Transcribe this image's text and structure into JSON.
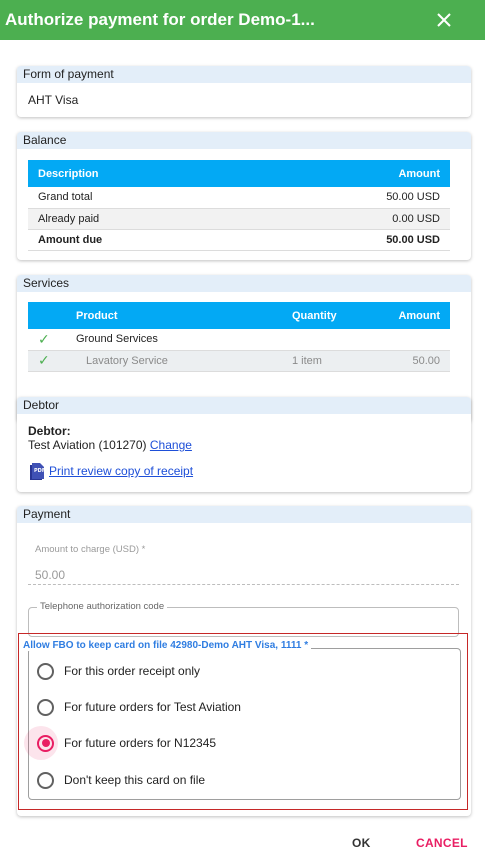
{
  "dialog": {
    "title": "Authorize payment for order Demo-1..."
  },
  "form_of_payment": {
    "heading": "Form of payment",
    "value": "AHT Visa"
  },
  "balance": {
    "heading": "Balance",
    "columns": {
      "description": "Description",
      "amount": "Amount"
    },
    "rows": [
      {
        "label": "Grand total",
        "amount": "50.00 USD"
      },
      {
        "label": "Already paid",
        "amount": "0.00 USD"
      },
      {
        "label": "Amount due",
        "amount": "50.00 USD"
      }
    ]
  },
  "services": {
    "heading": "Services",
    "columns": {
      "product": "Product",
      "quantity": "Quantity",
      "amount": "Amount"
    },
    "rows": [
      {
        "product": "Ground Services",
        "quantity": "",
        "amount": ""
      },
      {
        "product": "Lavatory Service",
        "quantity": "1 item",
        "amount": "50.00"
      }
    ]
  },
  "debtor": {
    "heading": "Debtor",
    "label": "Debtor:",
    "name": "Test Aviation (101270)",
    "change_link": "Change",
    "print_link": "Print review copy of receipt"
  },
  "payment": {
    "heading": "Payment",
    "amount_label": "Amount to charge (USD) *",
    "amount_value": "50.00",
    "telephone_label": "Telephone authorization code",
    "telephone_value": "",
    "keep_card": {
      "label": "Allow FBO to keep card on file 42980-Demo AHT Visa, 1111 *",
      "options": [
        "For this order receipt only",
        "For future orders for Test Aviation",
        "For future orders for N12345",
        "Don't keep this card on file"
      ],
      "selected_index": 2
    }
  },
  "footer": {
    "ok_label": "OK",
    "cancel_label": "CANCEL"
  },
  "colors": {
    "header_bg": "#4caf50",
    "table_header_bg": "#03a9f4",
    "accent": "#e91e63",
    "link": "#1e4fd8",
    "focus_border": "#c62828"
  }
}
